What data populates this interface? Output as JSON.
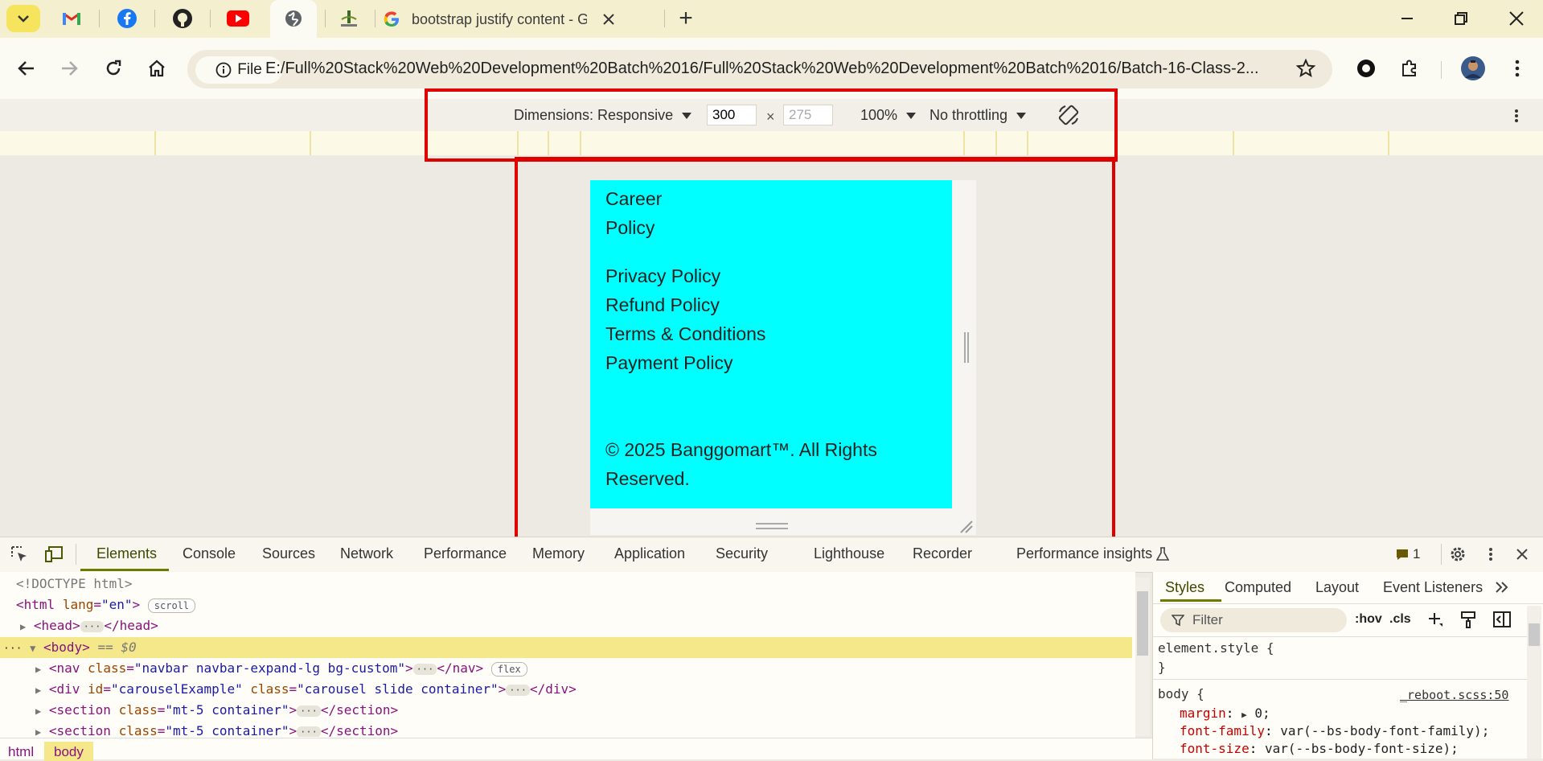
{
  "browser": {
    "tab_title": "bootstrap justify content - Goo",
    "new_tab_symbol": "+",
    "url": "E:/Full%20Stack%20Web%20Development%20Batch%2016/Full%20Stack%20Web%20Development%20Batch%2016/Batch-16-Class-2...",
    "file_chip_label": "File"
  },
  "device_toolbar": {
    "dimensions_label": "Dimensions: Responsive",
    "width_value": "300",
    "height_placeholder": "275",
    "times_symbol": "×",
    "zoom": "100%",
    "throttling": "No throttling"
  },
  "device_page": {
    "links_group1": [
      "Career",
      "Policy"
    ],
    "links_group2": [
      "Privacy Policy",
      "Refund Policy",
      "Terms & Conditions",
      "Payment Policy"
    ],
    "copyright_line1": "© 2025 Banggomart™. All Rights",
    "copyright_line2": "Reserved.",
    "background_color": "#00ffff"
  },
  "devtools": {
    "tabs": [
      "Elements",
      "Console",
      "Sources",
      "Network",
      "Performance",
      "Memory",
      "Application",
      "Security",
      "Lighthouse",
      "Recorder",
      "Performance insights"
    ],
    "issues_count": "1",
    "elements": {
      "doctype": "<!DOCTYPE html>",
      "html_open": "<html",
      "html_attr": "lang",
      "html_val": "\"en\"",
      "scroll_badge": "scroll",
      "head_open": "<head>",
      "head_close": "</head>",
      "body_open": "<body>",
      "body_eq": "== $0",
      "nav_open": "<nav",
      "nav_attr": "class",
      "nav_val": "\"navbar navbar-expand-lg bg-custom\"",
      "nav_close": "</nav>",
      "flex_badge": "flex",
      "div_open": "<div",
      "div_attr1": "id",
      "div_val1": "\"carouselExample\"",
      "div_attr2": "class",
      "div_val2": "\"carousel slide container\"",
      "div_close": "</div>",
      "section_open": "<section",
      "section_attr": "class",
      "section_val": "\"mt-5 container\"",
      "section_close": "</section>",
      "tag_close": ">",
      "equals": "=",
      "dots": "···"
    },
    "breadcrumbs": [
      "html",
      "body"
    ],
    "styles": {
      "tabs": [
        "Styles",
        "Computed",
        "Layout",
        "Event Listeners"
      ],
      "filter_placeholder": "Filter",
      "hov": ":hov",
      "cls": ".cls",
      "element_style": "element.style {",
      "close_brace": "}",
      "body_selector": "body {",
      "source": "_reboot.scss:50",
      "rules": [
        {
          "prop": "margin",
          "value": "0;"
        },
        {
          "prop": "font-family",
          "value": "var(--bs-body-font-family);"
        },
        {
          "prop": "font-size",
          "value": "var(--bs-body-font-size);"
        }
      ]
    }
  }
}
